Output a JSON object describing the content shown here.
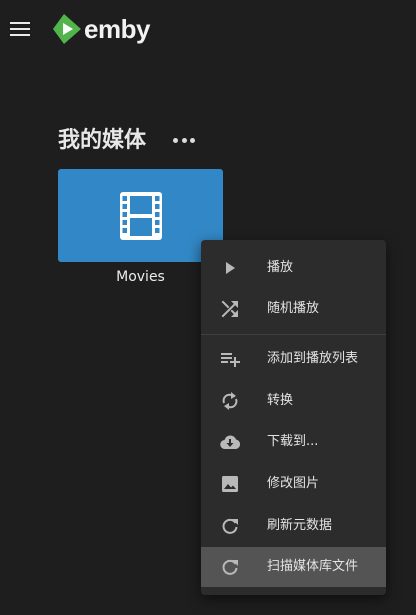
{
  "header": {
    "brand": "emby"
  },
  "section": {
    "title": "我的媒体"
  },
  "library": {
    "name": "Movies",
    "tile_color": "#3288c6"
  },
  "context_menu": {
    "items": [
      {
        "label": "播放",
        "icon": "play-icon"
      },
      {
        "label": "随机播放",
        "icon": "shuffle-icon"
      },
      {
        "label": "添加到播放列表",
        "icon": "playlist-add-icon"
      },
      {
        "label": "转换",
        "icon": "sync-icon"
      },
      {
        "label": "下载到...",
        "icon": "cloud-download-icon"
      },
      {
        "label": "修改图片",
        "icon": "image-icon"
      },
      {
        "label": "刷新元数据",
        "icon": "refresh-icon"
      },
      {
        "label": "扫描媒体库文件",
        "icon": "refresh-icon"
      }
    ],
    "active_item": "扫描媒体库文件",
    "highlight_color": "#545454"
  },
  "colors": {
    "background": "#1e1e1e",
    "brand_green": "#52b54b",
    "menu_background": "#2c2c2c"
  }
}
